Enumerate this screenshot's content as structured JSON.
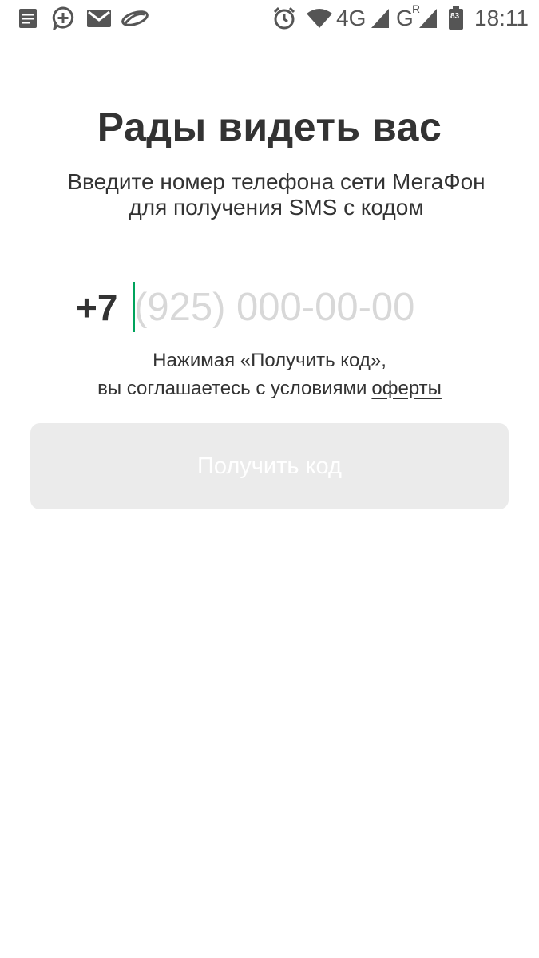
{
  "status_bar": {
    "time": "18:11",
    "network_4g": "4G",
    "network_g": "G",
    "roaming": "R",
    "battery": "83",
    "icons": {
      "notes": "notes-icon",
      "add_message": "add-message-icon",
      "mail": "mail-icon",
      "cloud": "cloud-icon",
      "alarm": "alarm-icon",
      "wifi": "wifi-icon",
      "signal": "signal-icon",
      "battery": "battery-icon"
    }
  },
  "login": {
    "title": "Рады видеть вас",
    "subtitle_line1": "Введите номер телефона сети МегаФон",
    "subtitle_line2": "для получения SMS с кодом",
    "phone_prefix": "+7",
    "phone_value": "",
    "phone_placeholder": "(925) 000-00-00",
    "terms_line1": "Нажимая «Получить код»,",
    "terms_line2": "вы соглашаетесь с условиями",
    "terms_link": "оферты",
    "button_label": "Получить код"
  },
  "colors": {
    "accent": "#00a35c",
    "text": "#333333",
    "placeholder": "#d8d8d8",
    "button_disabled_bg": "#ebebeb",
    "button_disabled_text": "#ffffff"
  }
}
